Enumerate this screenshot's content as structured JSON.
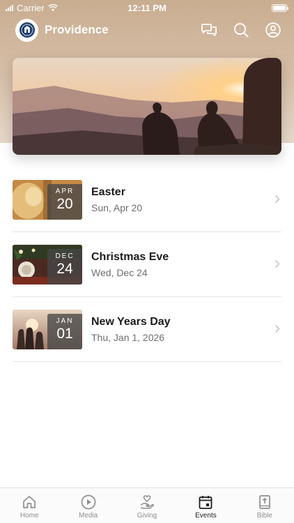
{
  "status_bar": {
    "carrier": "Carrier",
    "time": "12:11 PM",
    "battery_level": 1.0
  },
  "app_bar": {
    "title": "Providence",
    "logo_icon": "church-seal-icon",
    "actions": [
      "chat-icon",
      "search-icon",
      "profile-icon"
    ]
  },
  "hero": {
    "image": "sunset-mountains-people-photo"
  },
  "events": [
    {
      "month": "APR",
      "day": "20",
      "title": "Easter",
      "date": "Sun, Apr 20",
      "thumb": "bread-photo"
    },
    {
      "month": "DEC",
      "day": "24",
      "title": "Christmas Eve",
      "date": "Wed, Dec 24",
      "thumb": "dinner-table-photo"
    },
    {
      "month": "JAN",
      "day": "01",
      "title": "New Years Day",
      "date": "Thu, Jan 1, 2026",
      "thumb": "sunset-crowd-photo"
    }
  ],
  "tab_bar": {
    "active": "Events",
    "tabs": [
      {
        "label": "Home",
        "icon": "home-icon"
      },
      {
        "label": "Media",
        "icon": "play-circle-icon"
      },
      {
        "label": "Giving",
        "icon": "hand-heart-icon"
      },
      {
        "label": "Events",
        "icon": "calendar-icon"
      },
      {
        "label": "Bible",
        "icon": "bible-icon"
      }
    ]
  },
  "colors": {
    "header_background": "#cdb299",
    "badge_background": "#4a4a4a",
    "inactive_tab": "#8e8e93",
    "active_tab": "#1c1c1e"
  }
}
